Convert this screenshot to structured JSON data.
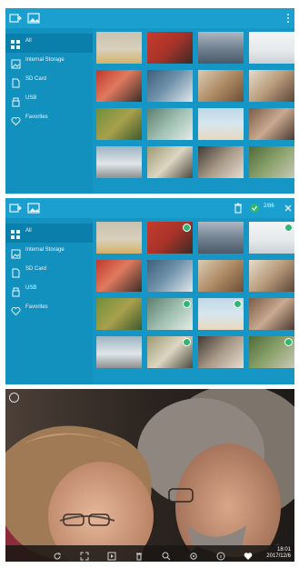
{
  "sidebar": {
    "items": [
      {
        "label": "All",
        "icon": "grid-icon"
      },
      {
        "label": "Internal Storage",
        "icon": "storage-icon"
      },
      {
        "label": "SD Card",
        "icon": "sd-card-icon"
      },
      {
        "label": "USB",
        "icon": "usb-icon"
      },
      {
        "label": "Favorites",
        "icon": "heart-icon"
      }
    ]
  },
  "selection": {
    "count": "2/86"
  },
  "viewer": {
    "time": "18:01",
    "date": "2017/12/6"
  },
  "colors": {
    "panel": "#1596c4",
    "sidebar_active": "#0b7fac",
    "check": "#2eb872"
  },
  "thumbs": [
    {
      "bg": "linear-gradient(180deg,#c9c2b0 0%,#d8d0bb 55%,#d4b36a 100%)"
    },
    {
      "bg": "linear-gradient(135deg,#c73a2c 0%,#a8332a 50%,#3a2b25 100%)"
    },
    {
      "bg": "linear-gradient(180deg,#aeb7c1 0%,#6f7f8e 55%,#4a5a68 100%)"
    },
    {
      "bg": "linear-gradient(180deg,#f2f4f5 0%,#e6e9ea 60%,#c9d1d6 100%)"
    },
    {
      "bg": "linear-gradient(135deg,#c0392b 0%,#e07a5f 45%,#3b2e27 100%)"
    },
    {
      "bg": "linear-gradient(135deg,#3d5f7a 0%,#6d8fa8 45%,#dfe7ec 100%)"
    },
    {
      "bg": "linear-gradient(135deg,#d9cbb4 0%,#b08c66 50%,#6d4e36 100%)"
    },
    {
      "bg": "linear-gradient(135deg,#e6dccd 0%,#b89b7a 50%,#5c463a 100%)"
    },
    {
      "bg": "linear-gradient(135deg,#6f8f3a 0%,#a8a04d 50%,#3f5a2a 100%)"
    },
    {
      "bg": "linear-gradient(135deg,#5d7f6e 0%,#9fbfb0 50%,#e5ece8 100%)"
    },
    {
      "bg": "linear-gradient(180deg,#bfd8e6 0%,#d7e7ee 50%,#e9d8bd 100%)"
    },
    {
      "bg": "linear-gradient(135deg,#7a5c49 0%,#c9a98f 50%,#4a3a33 100%)"
    },
    {
      "bg": "linear-gradient(180deg,#9cb4c2 0%,#dfe6e9 55%,#8d8f8f 100%)"
    },
    {
      "bg": "linear-gradient(135deg,#9a9a72 0%,#ddd6c2 50%,#4a4a42 100%)"
    },
    {
      "bg": "linear-gradient(135deg,#3f3a36 0%,#a89886 50%,#e7ddd2 100%)"
    },
    {
      "bg": "linear-gradient(135deg,#4f6b3a 0%,#8aa16a 50%,#c9c9b8 100%)"
    }
  ],
  "selected_thumbs": [
    1,
    3,
    9,
    10,
    13,
    15
  ]
}
